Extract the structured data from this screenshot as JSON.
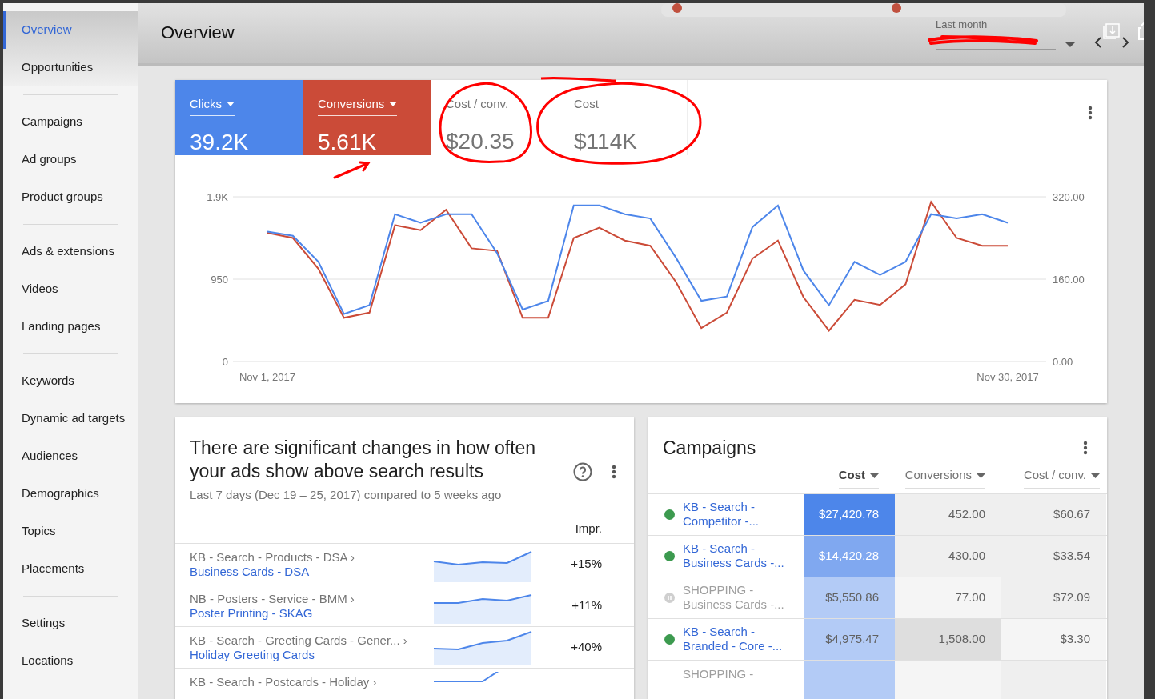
{
  "sidebar": {
    "groups": [
      [
        {
          "label": "Overview",
          "selected": true
        },
        {
          "label": "Opportunities",
          "selected": false
        }
      ],
      [
        {
          "label": "Campaigns",
          "selected": false
        },
        {
          "label": "Ad groups",
          "selected": false
        },
        {
          "label": "Product groups",
          "selected": false
        }
      ],
      [
        {
          "label": "Ads & extensions",
          "selected": false
        },
        {
          "label": "Videos",
          "selected": false
        },
        {
          "label": "Landing pages",
          "selected": false
        }
      ],
      [
        {
          "label": "Keywords",
          "selected": false
        },
        {
          "label": "Dynamic ad targets",
          "selected": false
        },
        {
          "label": "Audiences",
          "selected": false
        },
        {
          "label": "Demographics",
          "selected": false
        },
        {
          "label": "Topics",
          "selected": false
        },
        {
          "label": "Placements",
          "selected": false
        }
      ],
      [
        {
          "label": "Settings",
          "selected": false
        },
        {
          "label": "Locations",
          "selected": false
        }
      ]
    ]
  },
  "header": {
    "title": "Overview",
    "date_range": {
      "label": "Last month"
    }
  },
  "metrics": [
    {
      "label": "Clicks",
      "value": "39.2K",
      "selected": true,
      "color": "#4d86ea"
    },
    {
      "label": "Conversions",
      "value": "5.61K",
      "selected": true,
      "color": "#cb4b38"
    },
    {
      "label": "Cost / conv.",
      "value": "$20.35",
      "selected": false
    },
    {
      "label": "Cost",
      "value": "$114K",
      "selected": false
    }
  ],
  "chart": {
    "chart_data": {
      "type": "line",
      "categories": [
        "Nov 1, 2017",
        null,
        null,
        null,
        null,
        null,
        null,
        null,
        null,
        null,
        null,
        null,
        null,
        null,
        null,
        null,
        null,
        null,
        null,
        null,
        null,
        null,
        null,
        null,
        null,
        null,
        null,
        null,
        null,
        "Nov 30, 2017"
      ],
      "ylim": [
        0,
        1900
      ],
      "yticks": [
        {
          "value": 0,
          "label": "0"
        },
        {
          "value": 950,
          "label": "950"
        },
        {
          "value": 1900,
          "label": "1.9K"
        }
      ],
      "y2lim": [
        0,
        320
      ],
      "y2ticks": [
        {
          "value": 0,
          "label": "0.00"
        },
        {
          "value": 160,
          "label": "160.00"
        },
        {
          "value": 320,
          "label": "320.00"
        }
      ],
      "series": [
        {
          "color": "#4d86ea",
          "values": [
            1500,
            1450,
            1150,
            550,
            650,
            1700,
            1600,
            1700,
            1700,
            1250,
            600,
            700,
            1800,
            1800,
            1700,
            1650,
            1200,
            700,
            750,
            1550,
            1800,
            1050,
            650,
            1150,
            1000,
            1150,
            1700,
            1650,
            1700,
            1600
          ]
        },
        {
          "color": "#cb4b38",
          "axis": "y2",
          "values": [
            250,
            240,
            180,
            85,
            95,
            265,
            255,
            295,
            220,
            215,
            85,
            85,
            240,
            260,
            235,
            225,
            155,
            65,
            95,
            200,
            235,
            125,
            60,
            120,
            110,
            150,
            310,
            240,
            225,
            225
          ]
        }
      ]
    }
  },
  "changes_card": {
    "title": "There are significant changes in how often your ads show above search results",
    "subtitle": "Last 7 days (Dec 19 – 25, 2017) compared to 5 weeks ago",
    "column": "Impr.",
    "rows": [
      {
        "path": "KB - Search - Products - DSA ›",
        "name": "Business Cards - DSA",
        "change": "+15%"
      },
      {
        "path": "NB - Posters - Service - BMM ›",
        "name": "Poster Printing - SKAG",
        "change": "+11%"
      },
      {
        "path": "KB - Search - Greeting Cards - Gener... ›",
        "name": "Holiday Greeting Cards",
        "change": "+40%"
      },
      {
        "path": "KB - Search - Postcards - Holiday ›"
      }
    ]
  },
  "campaigns_card": {
    "title": "Campaigns",
    "columns": [
      {
        "label": "Cost",
        "sorted": true
      },
      {
        "label": "Conversions",
        "sorted": false
      },
      {
        "label": "Cost / conv.",
        "sorted": false
      }
    ],
    "rows": [
      {
        "name": "KB - Search - Competitor -...",
        "paused": false,
        "cells": [
          {
            "text": "$27,420.78",
            "color": "#4d86ea"
          },
          {
            "text": "452.00",
            "color": "#efefef"
          },
          {
            "text": "$60.67",
            "color": "#efefef"
          }
        ]
      },
      {
        "name": "KB - Search - Business Cards -...",
        "paused": false,
        "cells": [
          {
            "text": "$14,420.28",
            "color": "#80a8f0"
          },
          {
            "text": "430.00",
            "color": "#efefef"
          },
          {
            "text": "$33.54",
            "color": "#efefef"
          }
        ]
      },
      {
        "name": "SHOPPING - Business Cards -...",
        "paused": true,
        "cells": [
          {
            "text": "$5,550.86",
            "color": "#b3cbf6"
          },
          {
            "text": "77.00",
            "color": "#f5f5f5"
          },
          {
            "text": "$72.09",
            "color": "#efefef"
          }
        ]
      },
      {
        "name": "KB - Search - Branded - Core -...",
        "paused": false,
        "cells": [
          {
            "text": "$4,975.47",
            "color": "#b3cbf6"
          },
          {
            "text": "1,508.00",
            "color": "#dedede"
          },
          {
            "text": "$3.30",
            "color": "#f5f5f5"
          }
        ]
      },
      {
        "name": "SHOPPING -",
        "paused": true,
        "cells": [
          {
            "color": "#b3cbf6"
          },
          {
            "color": "#f5f5f5"
          },
          {
            "color": "#efefef"
          }
        ]
      }
    ]
  }
}
